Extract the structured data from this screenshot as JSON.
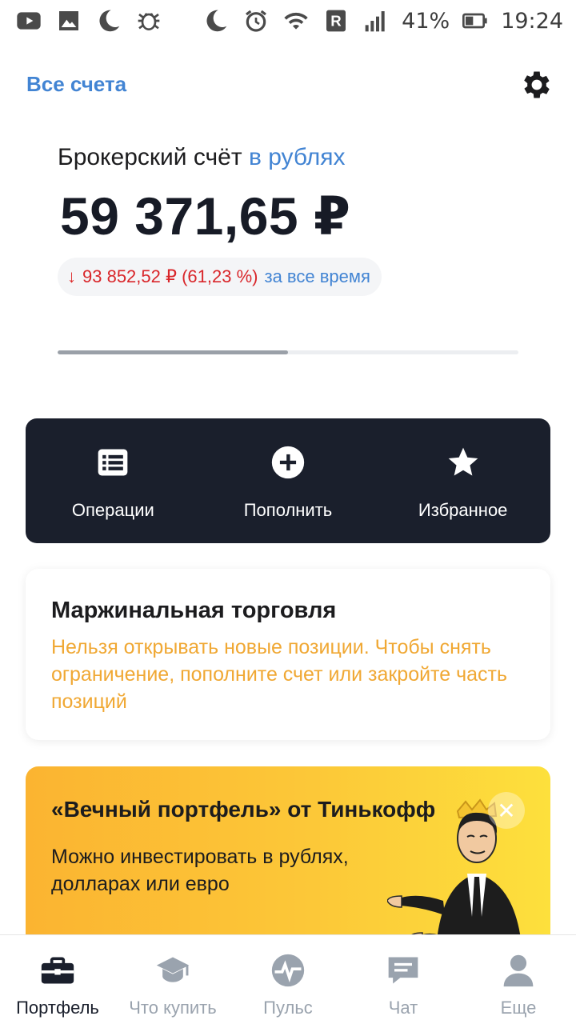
{
  "status_bar": {
    "left_icons": [
      "youtube-icon",
      "image-icon",
      "moon-icon",
      "bug-icon"
    ],
    "right_icons": [
      "moon-icon",
      "alarm-icon",
      "wifi-icon",
      "roaming-icon",
      "signal-icon"
    ],
    "battery": "41%",
    "time": "19:24"
  },
  "header": {
    "all_accounts": "Все счета",
    "settings_icon": "gear-icon"
  },
  "account": {
    "label": "Брокерский счёт",
    "currency_link": "в рублях",
    "balance": "59 371,65 ₽",
    "change": {
      "arrow": "↓",
      "value": "93 852,52 ₽ (61,23 %)",
      "period": "за все время",
      "color": "#d9262a"
    },
    "progress": 0.5
  },
  "actions": [
    {
      "label": "Операции",
      "icon": "list-icon"
    },
    {
      "label": "Пополнить",
      "icon": "plus-circle-icon"
    },
    {
      "label": "Избранное",
      "icon": "star-icon"
    }
  ],
  "margin_card": {
    "title": "Маржинальная торговля",
    "text": "Нельзя открывать новые позиции. Чтобы снять ограничение, пополните счет или закройте часть позиций",
    "text_color": "#f0a834"
  },
  "promo": {
    "title": "«Вечный портфель» от Тинькофф",
    "text": "Можно инвестировать в рублях, долларах или евро",
    "close": "✕"
  },
  "bottom_nav": [
    {
      "label": "Портфель",
      "icon": "briefcase-icon",
      "active": true
    },
    {
      "label": "Что купить",
      "icon": "graduation-cap-icon",
      "active": false
    },
    {
      "label": "Пульс",
      "icon": "pulse-icon",
      "active": false
    },
    {
      "label": "Чат",
      "icon": "chat-icon",
      "active": false
    },
    {
      "label": "Еще",
      "icon": "profile-icon",
      "active": false
    }
  ],
  "colors": {
    "accent": "#4284d3",
    "dark": "#1a1f2c",
    "negative": "#d9262a",
    "warning": "#f0a834",
    "promo_yellow": "#fcc838"
  }
}
